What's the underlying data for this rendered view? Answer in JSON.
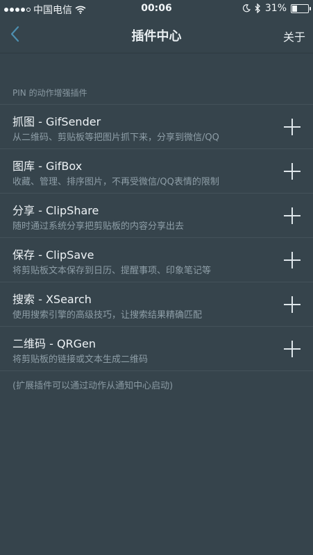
{
  "status_bar": {
    "carrier": "中国电信",
    "time": "00:06",
    "battery": "31%",
    "battery_level": 0.31,
    "icons": [
      "signal-dots-icon",
      "wifi-icon",
      "moon-icon",
      "bluetooth-icon",
      "battery-icon"
    ]
  },
  "nav": {
    "back_icon": "chevron-left-icon",
    "title": "插件中心",
    "about": "关于"
  },
  "section": {
    "header": "PIN 的动作增强插件"
  },
  "plugins": [
    {
      "title": "抓图 - GifSender",
      "subtitle": "从二维码、剪贴板等把图片抓下来，分享到微信/QQ"
    },
    {
      "title": "图库 - GifBox",
      "subtitle": "收藏、管理、排序图片，不再受微信/QQ表情的限制"
    },
    {
      "title": "分享 - ClipShare",
      "subtitle": "随时通过系统分享把剪贴板的内容分享出去"
    },
    {
      "title": "保存 - ClipSave",
      "subtitle": "将剪贴板文本保存到日历、提醒事项、印象笔记等"
    },
    {
      "title": "搜索 - XSearch",
      "subtitle": "使用搜索引擎的高级技巧，让搜索结果精确匹配"
    },
    {
      "title": "二维码 - QRGen",
      "subtitle": "将剪贴板的链接或文本生成二维码"
    }
  ],
  "footer": "(扩展插件可以通过动作从通知中心启动)",
  "colors": {
    "background": "#36444c",
    "accent": "#dfe7eb",
    "secondary_text": "#8e9ea7"
  }
}
